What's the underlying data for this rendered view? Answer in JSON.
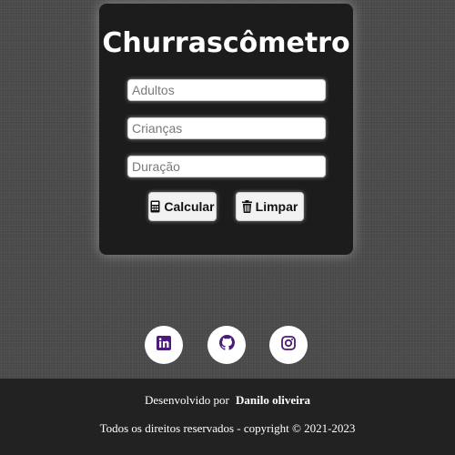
{
  "card": {
    "title": "Churrascômetro",
    "inputs": [
      {
        "placeholder": "Adultos",
        "value": ""
      },
      {
        "placeholder": "Crianças",
        "value": ""
      },
      {
        "placeholder": "Duração",
        "value": ""
      }
    ],
    "buttons": {
      "calculate_label": "Calcular",
      "calculate_icon": "calculator-icon",
      "clear_label": "Limpar",
      "clear_icon": "trash-icon"
    }
  },
  "social": [
    {
      "icon": "linkedin-icon"
    },
    {
      "icon": "github-icon"
    },
    {
      "icon": "instagram-icon"
    }
  ],
  "footer": {
    "developed_by": "Desenvolvido por",
    "author": "Danilo oliveira",
    "rights": "Todos os direitos reservados - copyright © 2021-2023"
  },
  "colors": {
    "background": "#4a4a4a",
    "card": "#1c1c1c",
    "footer": "#222222",
    "social_icon": "#4b1a7a"
  }
}
